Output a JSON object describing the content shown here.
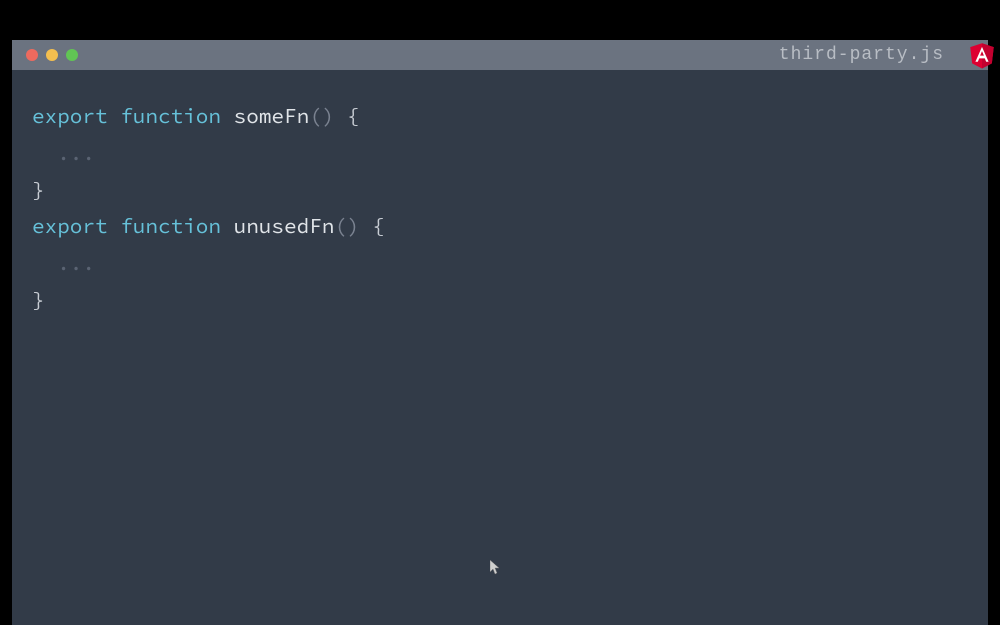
{
  "window": {
    "filename": "third-party.js"
  },
  "code": {
    "fn1": {
      "export_kw": "export",
      "function_kw": " function ",
      "name": "someFn",
      "parens": "()",
      "open_brace": " {",
      "body": "  ...",
      "close_brace": "}"
    },
    "blank": "",
    "fn2": {
      "export_kw": "export",
      "function_kw": " function ",
      "name": "unusedFn",
      "parens": "()",
      "open_brace": " {",
      "body": "  ...",
      "close_brace": "}"
    }
  },
  "icons": {
    "angular": "angular-shield-icon"
  },
  "colors": {
    "bg": "#323b48",
    "titlebar": "#6b7380",
    "keyword": "#66c1d9",
    "text": "#c8cdd4",
    "dim": "#5a6372",
    "angular_red": "#dd0031"
  }
}
